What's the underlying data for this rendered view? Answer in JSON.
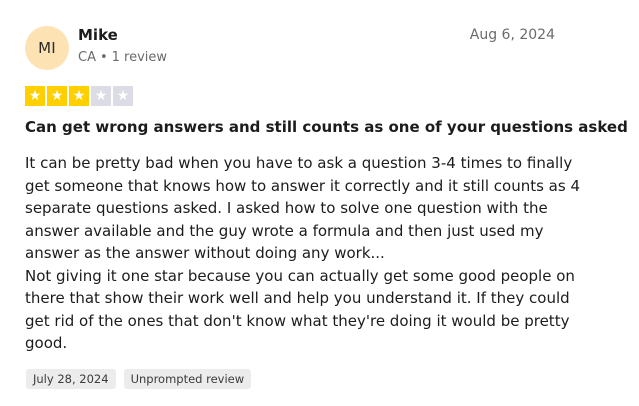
{
  "reviewer": {
    "initials": "MI",
    "name": "Mike",
    "country": "CA",
    "review_count": "1 review"
  },
  "review": {
    "date": "Aug 6, 2024",
    "rating": 3,
    "max_rating": 5,
    "title": "Can get wrong answers and still counts as one of your questions asked",
    "paragraphs": [
      "It can be pretty bad when you have to ask a question 3-4 times to finally get someone that knows how to answer it correctly and it still counts as 4 separate questions asked. I asked how to solve one question with the answer available and the guy wrote a formula and then just used my answer as the answer without doing any work...",
      "Not giving it one star because you can actually get some good people on there that show their work well and help you understand it. If they could get rid of the ones that don't know what they're doing it would be pretty good."
    ],
    "experience_date": "July 28, 2024",
    "source_tag": "Unprompted review"
  },
  "colors": {
    "star_on": "#ffcf00",
    "star_off": "#dcdce6",
    "avatar_bg": "#fde2b3"
  }
}
